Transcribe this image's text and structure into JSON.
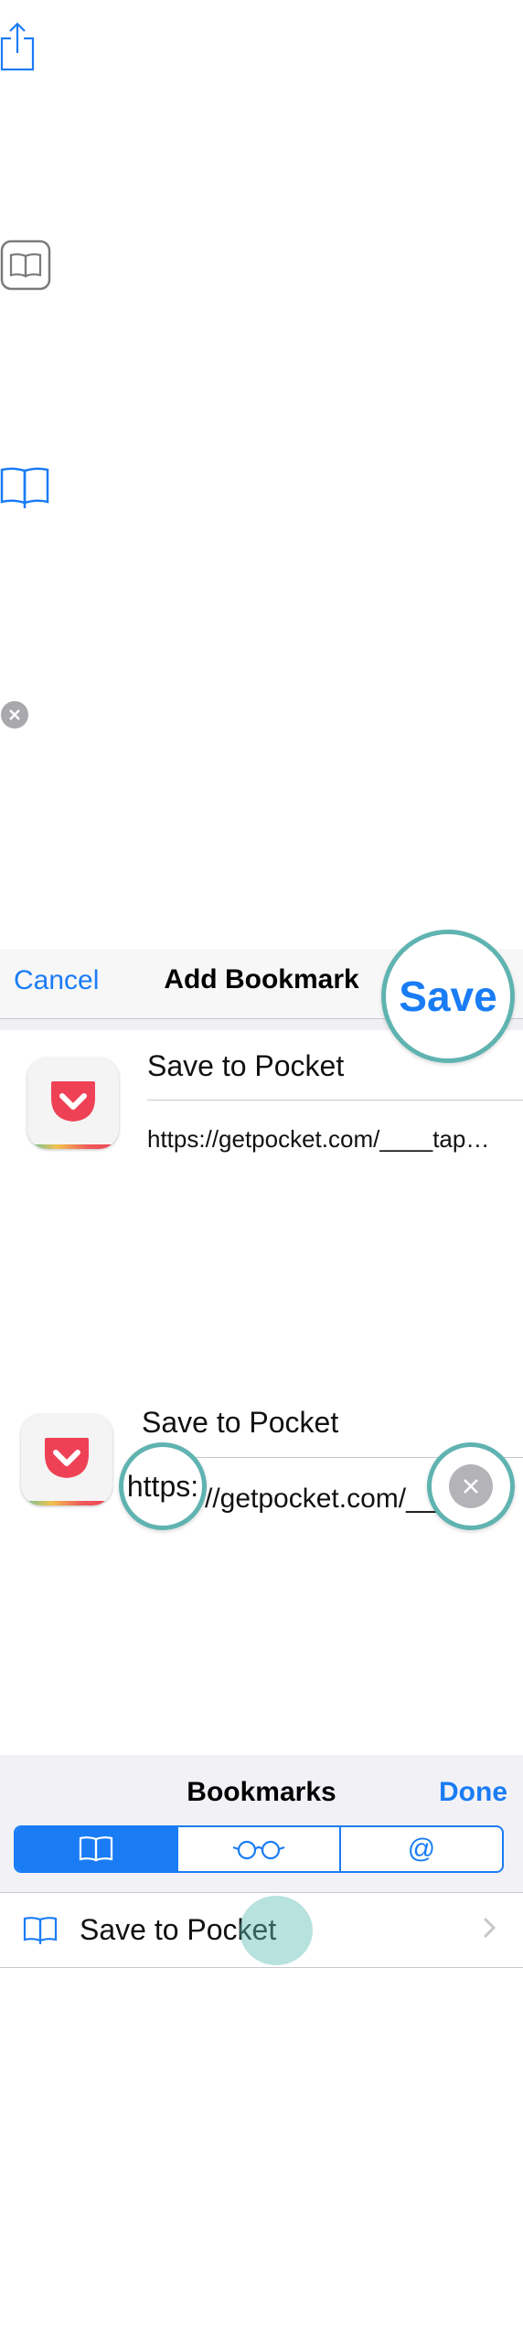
{
  "icons": {
    "share": "share-icon",
    "bookmark_button": "bookmarks-book-icon",
    "open_book": "open-book-icon",
    "clear": "clear-icon"
  },
  "add_bookmark": {
    "cancel_label": "Cancel",
    "title": "Add Bookmark",
    "save_label": "Save",
    "bookmark_title": "Save to Pocket",
    "bookmark_url": "https://getpocket.com/____tap…"
  },
  "zoom_detail": {
    "bookmark_title": "Save to Pocket",
    "url_prefix": "https:",
    "url_rest": "//getpocket.com/___"
  },
  "bookmarks": {
    "title": "Bookmarks",
    "done_label": "Done",
    "segments": [
      "bookmarks",
      "reading-list",
      "shared-links"
    ],
    "segment_at": "@",
    "items": [
      {
        "label": "Save to Pocket"
      }
    ]
  },
  "colors": {
    "accent": "#1a7cf5",
    "highlight_ring": "#5fb3b0",
    "pocket_red": "#ef4156"
  }
}
